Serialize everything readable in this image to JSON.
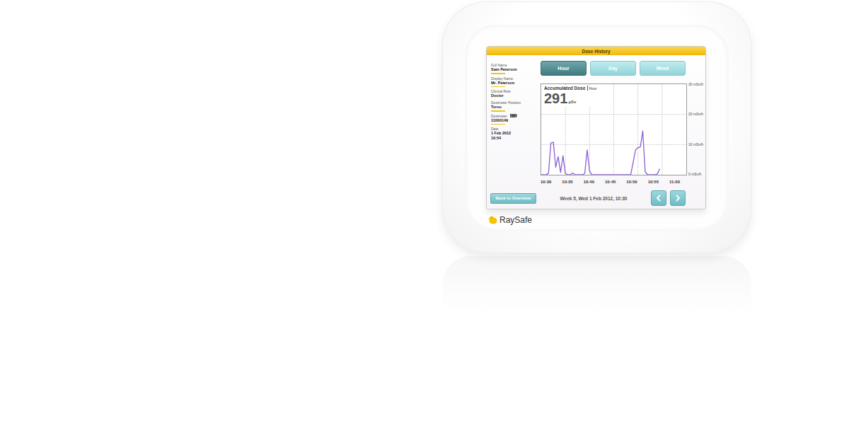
{
  "screen": {
    "title": "Dose History"
  },
  "profile": [
    {
      "label": "Full Name",
      "lines": [
        "Sam Peterson"
      ],
      "kind": "plain",
      "underlined": true
    },
    {
      "label": "Display Name",
      "lines": [
        "Mr. Peterson"
      ],
      "kind": "plain",
      "underlined": true
    },
    {
      "label": "Clinical Role",
      "lines": [
        "Doctor"
      ],
      "kind": "plain",
      "underlined": false
    },
    {
      "label": "Dosimeter Position",
      "lines": [
        "Torso"
      ],
      "kind": "plain",
      "underlined": true
    },
    {
      "label": "Dosimeter",
      "lines": [
        "11000149"
      ],
      "kind": "battery",
      "underlined": true
    },
    {
      "label": "Date",
      "lines": [
        "1 Feb 2012",
        "10:54"
      ],
      "kind": "plain",
      "underlined": false
    }
  ],
  "tabs": [
    {
      "label": "Hour",
      "selected": true
    },
    {
      "label": "Day",
      "selected": false
    },
    {
      "label": "Week",
      "selected": false
    }
  ],
  "chart": {
    "title": "Accumulated Dose",
    "period": "Hour",
    "total": "291",
    "unit": "μSv",
    "y_ticks": [
      "30 mSv/h",
      "20 mSv/h",
      "10 mSv/h",
      "0 mSv/h"
    ],
    "x_ticks": [
      "10:30",
      "10:35",
      "10:40",
      "10:45",
      "10:50",
      "10:55",
      "11:00"
    ],
    "series": [
      {
        "values": [
          0,
          0,
          0,
          0.5,
          10.5,
          10.8,
          2.5,
          6,
          0.8,
          6.3,
          0.4,
          0,
          0,
          0.6,
          0,
          0,
          0,
          0,
          0.4,
          8.2,
          1.2,
          0,
          0,
          0,
          0,
          0,
          0,
          0,
          0,
          0,
          0,
          0,
          0,
          0,
          0,
          0,
          0,
          0,
          4,
          8.2,
          9,
          9.2,
          14.5,
          1,
          0,
          0,
          0,
          0,
          0.2,
          2
        ]
      }
    ]
  },
  "footer": {
    "back_button": "Back to Overview",
    "period_label": "Week 5, Wed 1 Feb 2012, 10:30"
  },
  "brand": "RaySafe"
}
